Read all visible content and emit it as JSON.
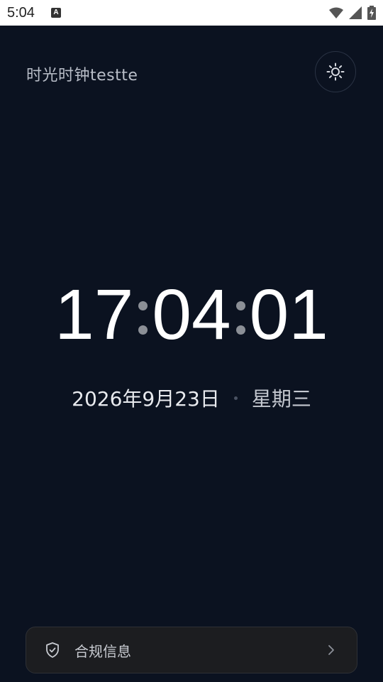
{
  "status_bar": {
    "time": "5:04",
    "notification_badge": "A"
  },
  "app": {
    "title": "时光时钟testte",
    "theme_toggle_icon": "sun-icon"
  },
  "clock": {
    "hours": "17",
    "minutes": "04",
    "seconds": "01"
  },
  "date": {
    "date_text": "2026年9月23日",
    "weekday": "星期三"
  },
  "footer": {
    "label": "合规信息",
    "icon": "shield-check-icon",
    "chevron": "chevron-right-icon"
  },
  "colors": {
    "background": "#0b1220",
    "card": "#1c1d20",
    "clock_text": "#ffffff",
    "colon": "#8b8f96"
  }
}
